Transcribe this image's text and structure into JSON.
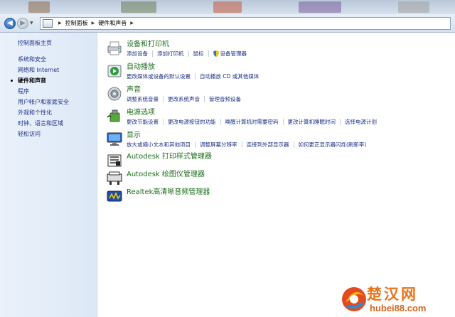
{
  "address_bar": {
    "breadcrumbs": [
      "控制面板",
      "硬件和声音"
    ]
  },
  "sidebar": {
    "home": "控制面板主页",
    "items": [
      {
        "label": "系统和安全",
        "current": false
      },
      {
        "label": "网络和 Internet",
        "current": false
      },
      {
        "label": "硬件和声音",
        "current": true
      },
      {
        "label": "程序",
        "current": false
      },
      {
        "label": "用户帐户和家庭安全",
        "current": false
      },
      {
        "label": "外观和个性化",
        "current": false
      },
      {
        "label": "时钟、语言和区域",
        "current": false
      },
      {
        "label": "轻松访问",
        "current": false
      }
    ]
  },
  "categories": [
    {
      "title": "设备和打印机",
      "icon": "printer-icon",
      "links": [
        "添加设备",
        "添加打印机",
        "鼠标",
        "设备管理器"
      ]
    },
    {
      "title": "自动播放",
      "icon": "autoplay-icon",
      "links": [
        "更改媒体或设备的默认设置",
        "自动播放 CD 或其他媒体"
      ]
    },
    {
      "title": "声音",
      "icon": "speaker-icon",
      "links": [
        "调整系统音量",
        "更改系统声音",
        "管理音频设备"
      ]
    },
    {
      "title": "电源选项",
      "icon": "power-options-icon",
      "links": [
        "更改节能设置",
        "更改电源按钮的功能",
        "唤醒计算机时需要密码",
        "更改计算机睡眠时间",
        "选择电源计划"
      ]
    },
    {
      "title": "显示",
      "icon": "display-icon",
      "links": [
        "放大或缩小文本和其他项目",
        "调整屏幕分辨率",
        "连接到外部显示器",
        "如何更正显示器闪烁(刷新率)"
      ]
    },
    {
      "title": "Autodesk 打印样式管理器",
      "icon": "autodesk-print-style-icon",
      "links": []
    },
    {
      "title": "Autodesk 绘图仪管理器",
      "icon": "autodesk-plotter-icon",
      "links": []
    },
    {
      "title": "Realtek高清晰音频管理器",
      "icon": "realtek-audio-icon",
      "links": []
    }
  ],
  "watermark": {
    "text": "楚汉网",
    "url": "hubei88.com"
  }
}
